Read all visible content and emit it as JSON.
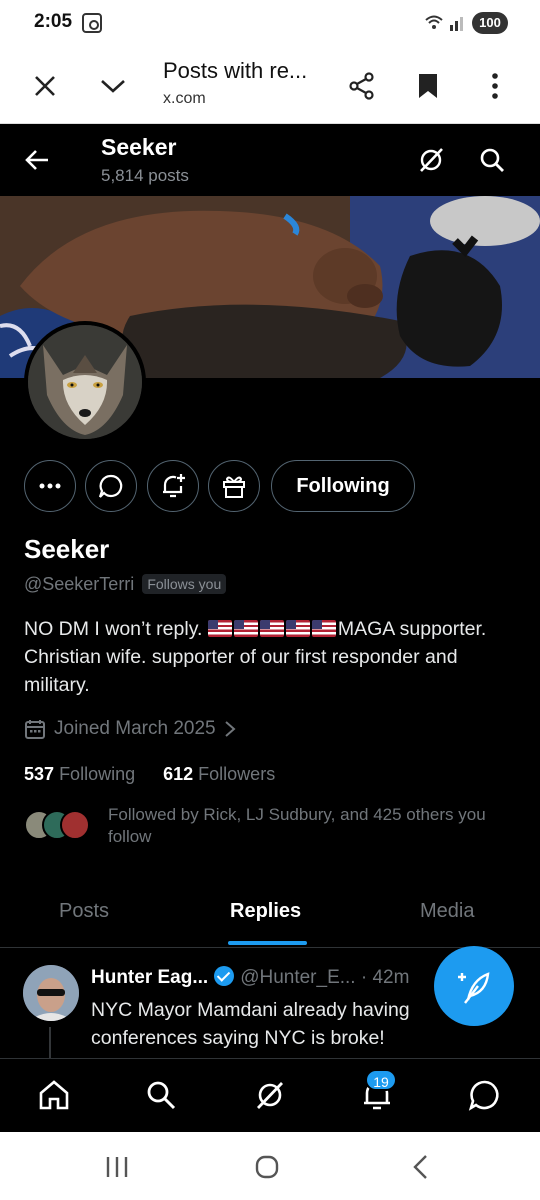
{
  "status_bar": {
    "time": "2:05",
    "wifi_label": "5",
    "battery": "100"
  },
  "browser": {
    "title": "Posts with re...",
    "url": "x.com"
  },
  "profile_header": {
    "name": "Seeker",
    "post_count": "5,814 posts"
  },
  "profile": {
    "display_name": "Seeker",
    "handle": "@SeekerTerri",
    "follows_you": "Follows you",
    "bio_before": "NO DM I won’t reply.",
    "bio_after": "MAGA supporter. Christian wife. supporter of our first responder and military.",
    "flag_count": 5,
    "joined": "Joined March 2025",
    "following_count": "537",
    "following_label": "Following",
    "followers_count": "612",
    "followers_label": "Followers",
    "followed_by": "Followed by Rick, LJ Sudbury, and 425 others you follow"
  },
  "actions": {
    "follow_state": "Following"
  },
  "tabs": [
    {
      "label": "Posts",
      "active": false
    },
    {
      "label": "Replies",
      "active": true
    },
    {
      "label": "Media",
      "active": false
    }
  ],
  "post": {
    "author": "Hunter Eag...",
    "handle": "@Hunter_E...",
    "time": "· 42m",
    "text": "NYC Mayor Mamdani already having conferences saying NYC is broke!"
  },
  "bottom_nav": {
    "notification_badge": "19"
  },
  "colors": {
    "accent": "#1d9bf0",
    "background": "#000000",
    "muted": "#71767b"
  }
}
